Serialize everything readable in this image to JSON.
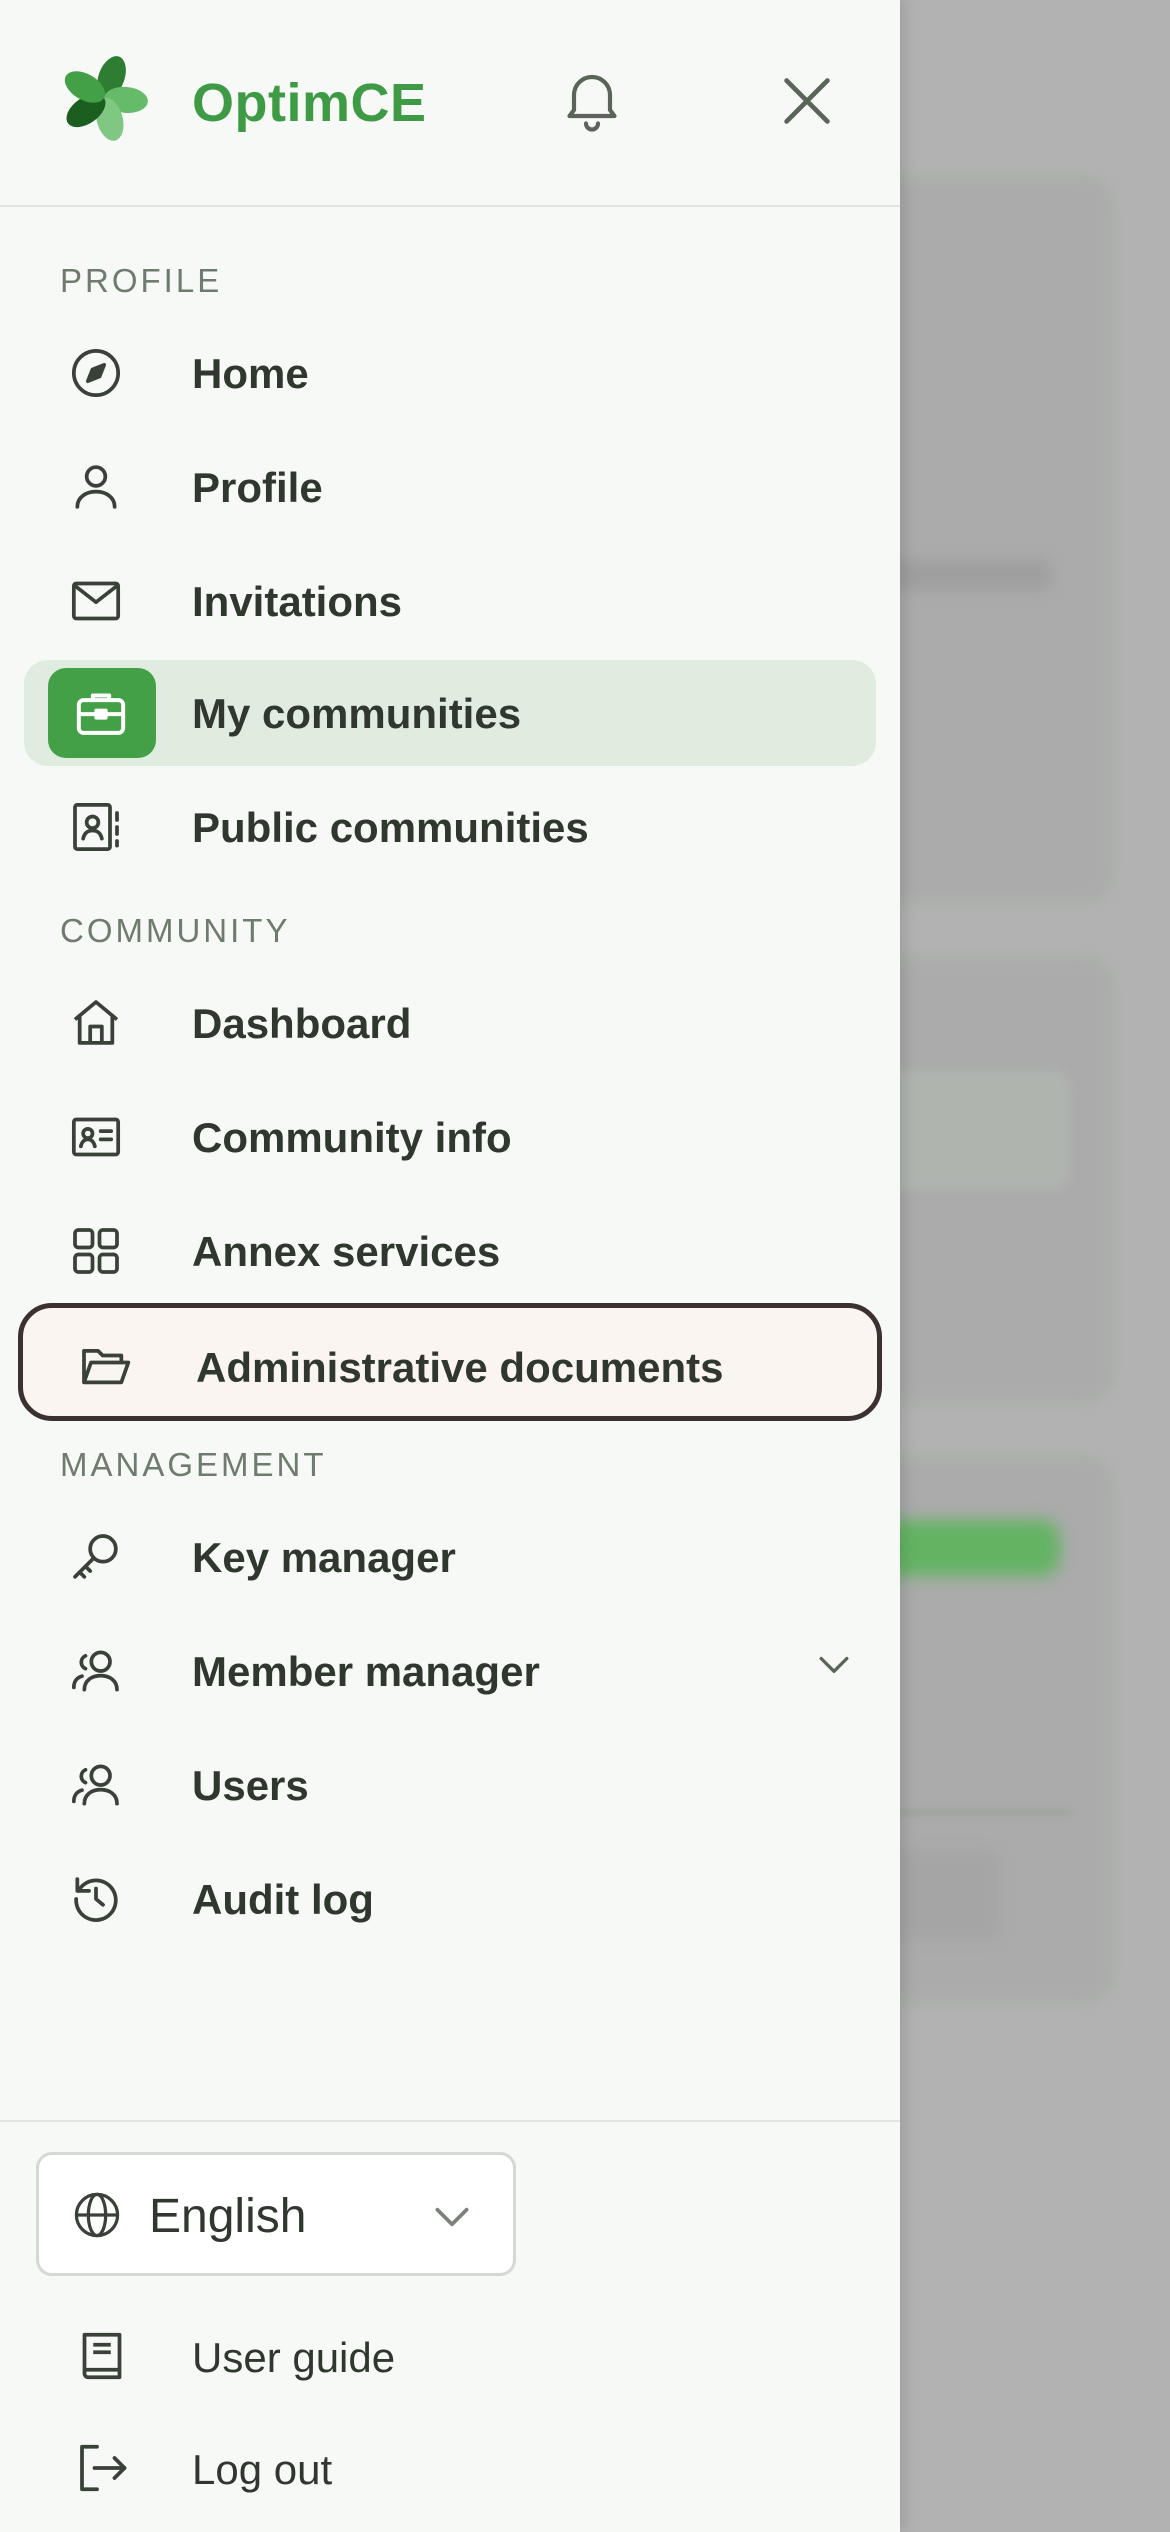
{
  "app": {
    "brand": "OptimCE",
    "colors": {
      "accent": "#43a047",
      "brand_text": "#3e9a44",
      "active_bg": "#e0ece0",
      "focus_border": "#3a3130",
      "text": "#30372f",
      "section_label": "#6f7b6e"
    }
  },
  "header": {
    "logo_icon": "clover-logo",
    "bell_icon": "bell-icon",
    "close_icon": "close-icon"
  },
  "sections": {
    "profile": "PROFILE",
    "community": "COMMUNITY",
    "management": "MANAGEMENT"
  },
  "nav": {
    "home": {
      "label": "Home",
      "icon": "compass-icon"
    },
    "profile": {
      "label": "Profile",
      "icon": "user-icon"
    },
    "invitations": {
      "label": "Invitations",
      "icon": "envelope-icon"
    },
    "my_communities": {
      "label": "My communities",
      "icon": "briefcase-icon",
      "state": "active"
    },
    "public_communities": {
      "label": "Public communities",
      "icon": "contact-book-icon"
    },
    "dashboard": {
      "label": "Dashboard",
      "icon": "house-icon"
    },
    "community_info": {
      "label": "Community info",
      "icon": "id-card-icon"
    },
    "annex_services": {
      "label": "Annex services",
      "icon": "grid-icon"
    },
    "administrative_documents": {
      "label": "Administrative documents",
      "icon": "folder-open-icon",
      "state": "focused"
    },
    "key_manager": {
      "label": "Key manager",
      "icon": "key-icon"
    },
    "member_manager": {
      "label": "Member manager",
      "icon": "users-icon",
      "expandable": true
    },
    "users": {
      "label": "Users",
      "icon": "users-icon"
    },
    "audit_log": {
      "label": "Audit log",
      "icon": "history-icon"
    }
  },
  "footer": {
    "language": {
      "selected": "English",
      "icon": "globe-icon"
    },
    "user_guide": {
      "label": "User guide",
      "icon": "book-icon"
    },
    "log_out": {
      "label": "Log out",
      "icon": "logout-icon"
    }
  }
}
